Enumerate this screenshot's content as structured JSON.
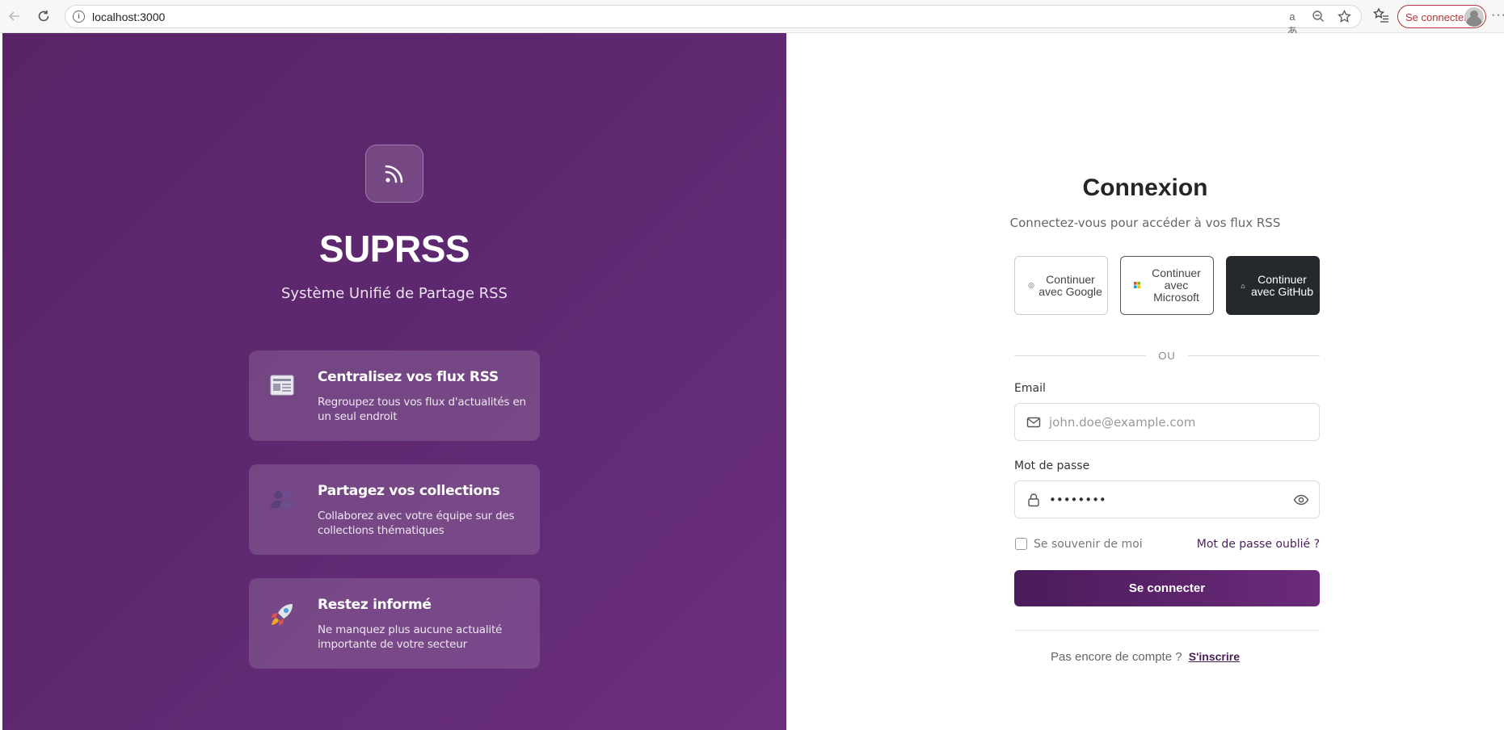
{
  "browser": {
    "url": "localhost:3000",
    "profile_label": "Se connecter"
  },
  "left": {
    "brand": "SUPRSS",
    "tagline": "Système Unifié de Partage RSS",
    "features": [
      {
        "icon": "newspaper-icon",
        "title": "Centralisez vos flux RSS",
        "desc": "Regroupez tous vos flux d'actualités en un seul endroit"
      },
      {
        "icon": "people-icon",
        "title": "Partagez vos collections",
        "desc": "Collaborez avec votre équipe sur des collections thématiques"
      },
      {
        "icon": "rocket-icon",
        "title": "Restez informé",
        "desc": "Ne manquez plus aucune actualité importante de votre secteur"
      }
    ]
  },
  "login": {
    "title": "Connexion",
    "subtitle": "Connectez-vous pour accéder à vos flux RSS",
    "sso": {
      "google": "Continuer avec Google",
      "microsoft": "Continuer avec Microsoft",
      "github": "Continuer avec GitHub"
    },
    "divider": "OU",
    "email_label": "Email",
    "email_placeholder": "john.doe@example.com",
    "password_label": "Mot de passe",
    "password_value": "••••••••",
    "remember": "Se souvenir de moi",
    "forgot": "Mot de passe oublié ?",
    "submit": "Se connecter",
    "no_account": "Pas encore de compte ?",
    "signup": "S'inscrire"
  },
  "colors": {
    "primary": "#5e2870",
    "github": "#25292e"
  }
}
